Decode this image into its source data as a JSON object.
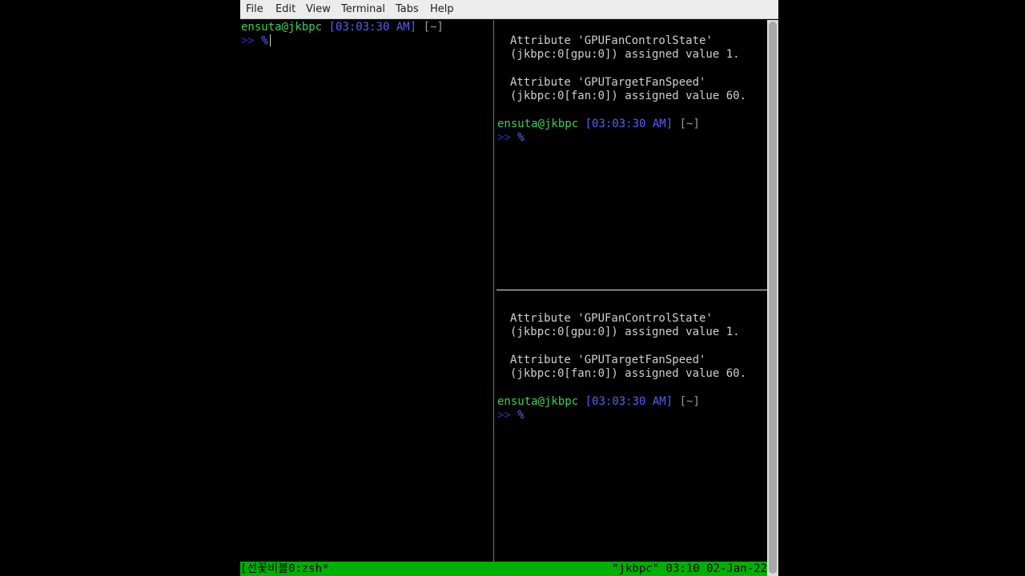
{
  "menu": [
    "File",
    "Edit",
    "View",
    "Terminal",
    "Tabs",
    "Help"
  ],
  "prompt": {
    "user": "ensuta@jkbpc",
    "time": "[03:03:30 AM]",
    "dir": "[~]",
    "arrow": ">>",
    "pct": "%"
  },
  "output": {
    "line1": "Attribute 'GPUFanControlState'",
    "line2": "(jkbpc:0[gpu:0]) assigned value 1.",
    "line3": "Attribute 'GPUTargetFanSpeed'",
    "line4": "(jkbpc:0[fan:0]) assigned value 60."
  },
  "status": {
    "left": "[선꽃비블0:zsh*",
    "right": "\"jkbpc\" 03:10 02-Jan-22"
  },
  "colors": {
    "prompt_user": "#39d353",
    "prompt_time": "#5a5cff",
    "status_bg": "#00b000",
    "pane_border": "#20b020"
  }
}
